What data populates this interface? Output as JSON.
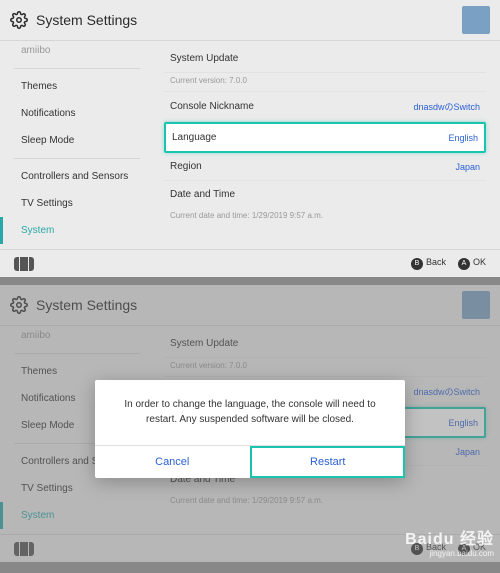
{
  "header": {
    "title": "System Settings"
  },
  "sidebar": {
    "cut_item": "amiibo",
    "items_a": [
      "Themes",
      "Notifications",
      "Sleep Mode"
    ],
    "items_b": [
      "Controllers and Sensors",
      "TV Settings",
      "System"
    ],
    "active": "System"
  },
  "content": {
    "system_update": {
      "label": "System Update",
      "sub_prefix": "Current version:",
      "version": "7.0.0"
    },
    "nickname": {
      "label": "Console Nickname",
      "value": "dnasdwのSwitch"
    },
    "language": {
      "label": "Language",
      "value": "English"
    },
    "region": {
      "label": "Region",
      "value": "Japan"
    },
    "datetime": {
      "label": "Date and Time",
      "sub_prefix": "Current date and time:",
      "value": "1/29/2019 9:57 a.m."
    }
  },
  "footer": {
    "back_key": "B",
    "back_label": "Back",
    "ok_key": "A",
    "ok_label": "OK"
  },
  "modal": {
    "message": "In order to change the language, the console will need to restart. Any suspended software will be closed.",
    "cancel": "Cancel",
    "restart": "Restart"
  },
  "watermark": {
    "brand": "Baidu 经验",
    "url": "jingyan.baidu.com"
  }
}
